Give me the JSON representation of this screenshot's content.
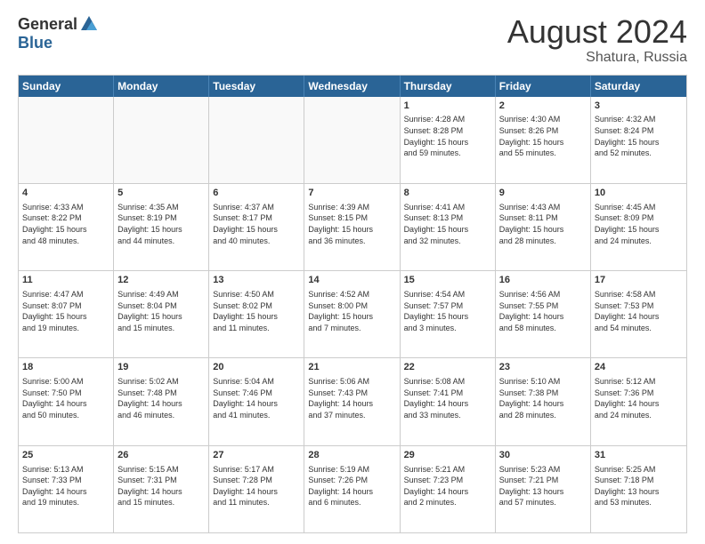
{
  "logo": {
    "general": "General",
    "blue": "Blue"
  },
  "title": {
    "month_year": "August 2024",
    "location": "Shatura, Russia"
  },
  "weekdays": [
    "Sunday",
    "Monday",
    "Tuesday",
    "Wednesday",
    "Thursday",
    "Friday",
    "Saturday"
  ],
  "rows": [
    [
      {
        "day": "",
        "detail": ""
      },
      {
        "day": "",
        "detail": ""
      },
      {
        "day": "",
        "detail": ""
      },
      {
        "day": "",
        "detail": ""
      },
      {
        "day": "1",
        "detail": "Sunrise: 4:28 AM\nSunset: 8:28 PM\nDaylight: 15 hours\nand 59 minutes."
      },
      {
        "day": "2",
        "detail": "Sunrise: 4:30 AM\nSunset: 8:26 PM\nDaylight: 15 hours\nand 55 minutes."
      },
      {
        "day": "3",
        "detail": "Sunrise: 4:32 AM\nSunset: 8:24 PM\nDaylight: 15 hours\nand 52 minutes."
      }
    ],
    [
      {
        "day": "4",
        "detail": "Sunrise: 4:33 AM\nSunset: 8:22 PM\nDaylight: 15 hours\nand 48 minutes."
      },
      {
        "day": "5",
        "detail": "Sunrise: 4:35 AM\nSunset: 8:19 PM\nDaylight: 15 hours\nand 44 minutes."
      },
      {
        "day": "6",
        "detail": "Sunrise: 4:37 AM\nSunset: 8:17 PM\nDaylight: 15 hours\nand 40 minutes."
      },
      {
        "day": "7",
        "detail": "Sunrise: 4:39 AM\nSunset: 8:15 PM\nDaylight: 15 hours\nand 36 minutes."
      },
      {
        "day": "8",
        "detail": "Sunrise: 4:41 AM\nSunset: 8:13 PM\nDaylight: 15 hours\nand 32 minutes."
      },
      {
        "day": "9",
        "detail": "Sunrise: 4:43 AM\nSunset: 8:11 PM\nDaylight: 15 hours\nand 28 minutes."
      },
      {
        "day": "10",
        "detail": "Sunrise: 4:45 AM\nSunset: 8:09 PM\nDaylight: 15 hours\nand 24 minutes."
      }
    ],
    [
      {
        "day": "11",
        "detail": "Sunrise: 4:47 AM\nSunset: 8:07 PM\nDaylight: 15 hours\nand 19 minutes."
      },
      {
        "day": "12",
        "detail": "Sunrise: 4:49 AM\nSunset: 8:04 PM\nDaylight: 15 hours\nand 15 minutes."
      },
      {
        "day": "13",
        "detail": "Sunrise: 4:50 AM\nSunset: 8:02 PM\nDaylight: 15 hours\nand 11 minutes."
      },
      {
        "day": "14",
        "detail": "Sunrise: 4:52 AM\nSunset: 8:00 PM\nDaylight: 15 hours\nand 7 minutes."
      },
      {
        "day": "15",
        "detail": "Sunrise: 4:54 AM\nSunset: 7:57 PM\nDaylight: 15 hours\nand 3 minutes."
      },
      {
        "day": "16",
        "detail": "Sunrise: 4:56 AM\nSunset: 7:55 PM\nDaylight: 14 hours\nand 58 minutes."
      },
      {
        "day": "17",
        "detail": "Sunrise: 4:58 AM\nSunset: 7:53 PM\nDaylight: 14 hours\nand 54 minutes."
      }
    ],
    [
      {
        "day": "18",
        "detail": "Sunrise: 5:00 AM\nSunset: 7:50 PM\nDaylight: 14 hours\nand 50 minutes."
      },
      {
        "day": "19",
        "detail": "Sunrise: 5:02 AM\nSunset: 7:48 PM\nDaylight: 14 hours\nand 46 minutes."
      },
      {
        "day": "20",
        "detail": "Sunrise: 5:04 AM\nSunset: 7:46 PM\nDaylight: 14 hours\nand 41 minutes."
      },
      {
        "day": "21",
        "detail": "Sunrise: 5:06 AM\nSunset: 7:43 PM\nDaylight: 14 hours\nand 37 minutes."
      },
      {
        "day": "22",
        "detail": "Sunrise: 5:08 AM\nSunset: 7:41 PM\nDaylight: 14 hours\nand 33 minutes."
      },
      {
        "day": "23",
        "detail": "Sunrise: 5:10 AM\nSunset: 7:38 PM\nDaylight: 14 hours\nand 28 minutes."
      },
      {
        "day": "24",
        "detail": "Sunrise: 5:12 AM\nSunset: 7:36 PM\nDaylight: 14 hours\nand 24 minutes."
      }
    ],
    [
      {
        "day": "25",
        "detail": "Sunrise: 5:13 AM\nSunset: 7:33 PM\nDaylight: 14 hours\nand 19 minutes."
      },
      {
        "day": "26",
        "detail": "Sunrise: 5:15 AM\nSunset: 7:31 PM\nDaylight: 14 hours\nand 15 minutes."
      },
      {
        "day": "27",
        "detail": "Sunrise: 5:17 AM\nSunset: 7:28 PM\nDaylight: 14 hours\nand 11 minutes."
      },
      {
        "day": "28",
        "detail": "Sunrise: 5:19 AM\nSunset: 7:26 PM\nDaylight: 14 hours\nand 6 minutes."
      },
      {
        "day": "29",
        "detail": "Sunrise: 5:21 AM\nSunset: 7:23 PM\nDaylight: 14 hours\nand 2 minutes."
      },
      {
        "day": "30",
        "detail": "Sunrise: 5:23 AM\nSunset: 7:21 PM\nDaylight: 13 hours\nand 57 minutes."
      },
      {
        "day": "31",
        "detail": "Sunrise: 5:25 AM\nSunset: 7:18 PM\nDaylight: 13 hours\nand 53 minutes."
      }
    ]
  ]
}
